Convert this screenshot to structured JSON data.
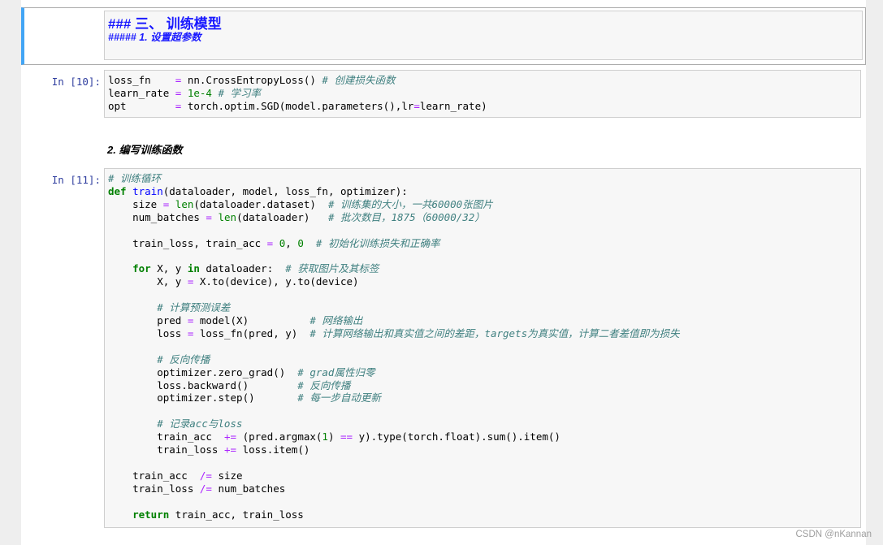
{
  "markdown_cell": {
    "heading": "### 三、 训练模型",
    "subheading": "##### 1. 设置超参数"
  },
  "cell_10": {
    "prompt": "In [10]:",
    "lines": [
      [
        {
          "t": "loss_fn    ",
          "c": "n"
        },
        {
          "t": "=",
          "c": "o"
        },
        {
          "t": " nn.CrossEntropyLoss() ",
          "c": "n"
        },
        {
          "t": "# 创建损失函数",
          "c": "c"
        }
      ],
      [
        {
          "t": "learn_rate ",
          "c": "n"
        },
        {
          "t": "=",
          "c": "o"
        },
        {
          "t": " ",
          "c": "n"
        },
        {
          "t": "1e-4",
          "c": "m"
        },
        {
          "t": " ",
          "c": "n"
        },
        {
          "t": "# 学习率",
          "c": "c"
        }
      ],
      [
        {
          "t": "opt        ",
          "c": "n"
        },
        {
          "t": "=",
          "c": "o"
        },
        {
          "t": " torch.optim.SGD(model.parameters(),lr",
          "c": "n"
        },
        {
          "t": "=",
          "c": "o"
        },
        {
          "t": "learn_rate)",
          "c": "n"
        }
      ]
    ]
  },
  "markdown_cell_2": {
    "text": "2. 编写训练函数"
  },
  "cell_11": {
    "prompt": "In [11]:",
    "lines": [
      [
        {
          "t": "# 训练循环",
          "c": "c"
        }
      ],
      [
        {
          "t": "def",
          "c": "k"
        },
        {
          "t": " ",
          "c": "n"
        },
        {
          "t": "train",
          "c": "f"
        },
        {
          "t": "(dataloader, model, loss_fn, optimizer):",
          "c": "n"
        }
      ],
      [
        {
          "t": "    size ",
          "c": "n"
        },
        {
          "t": "=",
          "c": "o"
        },
        {
          "t": " ",
          "c": "n"
        },
        {
          "t": "len",
          "c": "m"
        },
        {
          "t": "(dataloader.dataset)  ",
          "c": "n"
        },
        {
          "t": "# 训练集的大小，一共60000张图片",
          "c": "c"
        }
      ],
      [
        {
          "t": "    num_batches ",
          "c": "n"
        },
        {
          "t": "=",
          "c": "o"
        },
        {
          "t": " ",
          "c": "n"
        },
        {
          "t": "len",
          "c": "m"
        },
        {
          "t": "(dataloader)   ",
          "c": "n"
        },
        {
          "t": "# 批次数目，1875（60000/32）",
          "c": "c"
        }
      ],
      [
        {
          "t": "",
          "c": "n"
        }
      ],
      [
        {
          "t": "    train_loss, train_acc ",
          "c": "n"
        },
        {
          "t": "=",
          "c": "o"
        },
        {
          "t": " ",
          "c": "n"
        },
        {
          "t": "0",
          "c": "m"
        },
        {
          "t": ", ",
          "c": "n"
        },
        {
          "t": "0",
          "c": "m"
        },
        {
          "t": "  ",
          "c": "n"
        },
        {
          "t": "# 初始化训练损失和正确率",
          "c": "c"
        }
      ],
      [
        {
          "t": "",
          "c": "n"
        }
      ],
      [
        {
          "t": "    ",
          "c": "n"
        },
        {
          "t": "for",
          "c": "k"
        },
        {
          "t": " X, y ",
          "c": "n"
        },
        {
          "t": "in",
          "c": "k"
        },
        {
          "t": " dataloader:  ",
          "c": "n"
        },
        {
          "t": "# 获取图片及其标签",
          "c": "c"
        }
      ],
      [
        {
          "t": "        X, y ",
          "c": "n"
        },
        {
          "t": "=",
          "c": "o"
        },
        {
          "t": " X.to(device), y.to(device)",
          "c": "n"
        }
      ],
      [
        {
          "t": "",
          "c": "n"
        }
      ],
      [
        {
          "t": "        ",
          "c": "n"
        },
        {
          "t": "# 计算预测误差",
          "c": "c"
        }
      ],
      [
        {
          "t": "        pred ",
          "c": "n"
        },
        {
          "t": "=",
          "c": "o"
        },
        {
          "t": " model(X)          ",
          "c": "n"
        },
        {
          "t": "# 网络输出",
          "c": "c"
        }
      ],
      [
        {
          "t": "        loss ",
          "c": "n"
        },
        {
          "t": "=",
          "c": "o"
        },
        {
          "t": " loss_fn(pred, y)  ",
          "c": "n"
        },
        {
          "t": "# 计算网络输出和真实值之间的差距，targets为真实值，计算二者差值即为损失",
          "c": "c"
        }
      ],
      [
        {
          "t": "",
          "c": "n"
        }
      ],
      [
        {
          "t": "        ",
          "c": "n"
        },
        {
          "t": "# 反向传播",
          "c": "c"
        }
      ],
      [
        {
          "t": "        optimizer.zero_grad()  ",
          "c": "n"
        },
        {
          "t": "# grad属性归零",
          "c": "c"
        }
      ],
      [
        {
          "t": "        loss.backward()        ",
          "c": "n"
        },
        {
          "t": "# 反向传播",
          "c": "c"
        }
      ],
      [
        {
          "t": "        optimizer.step()       ",
          "c": "n"
        },
        {
          "t": "# 每一步自动更新",
          "c": "c"
        }
      ],
      [
        {
          "t": "",
          "c": "n"
        }
      ],
      [
        {
          "t": "        ",
          "c": "n"
        },
        {
          "t": "# 记录acc与loss",
          "c": "c"
        }
      ],
      [
        {
          "t": "        train_acc  ",
          "c": "n"
        },
        {
          "t": "+=",
          "c": "o"
        },
        {
          "t": " (pred.argmax(",
          "c": "n"
        },
        {
          "t": "1",
          "c": "m"
        },
        {
          "t": ") ",
          "c": "n"
        },
        {
          "t": "==",
          "c": "o"
        },
        {
          "t": " y).type(torch.float).sum().item()",
          "c": "n"
        }
      ],
      [
        {
          "t": "        train_loss ",
          "c": "n"
        },
        {
          "t": "+=",
          "c": "o"
        },
        {
          "t": " loss.item()",
          "c": "n"
        }
      ],
      [
        {
          "t": "",
          "c": "n"
        }
      ],
      [
        {
          "t": "    train_acc  ",
          "c": "n"
        },
        {
          "t": "/=",
          "c": "o"
        },
        {
          "t": " size",
          "c": "n"
        }
      ],
      [
        {
          "t": "    train_loss ",
          "c": "n"
        },
        {
          "t": "/=",
          "c": "o"
        },
        {
          "t": " num_batches",
          "c": "n"
        }
      ],
      [
        {
          "t": "",
          "c": "n"
        }
      ],
      [
        {
          "t": "    ",
          "c": "n"
        },
        {
          "t": "return",
          "c": "k"
        },
        {
          "t": " train_acc, train_loss",
          "c": "n"
        }
      ]
    ]
  },
  "watermark": "CSDN @nKannan",
  "colors": {
    "selected_border": "#42a5f5",
    "prompt": "#303f9f",
    "code_bg": "#f7f7f7",
    "comment": "#408080",
    "keyword": "#008000",
    "operator": "#aa22ff",
    "heading": "#1a1aff"
  }
}
